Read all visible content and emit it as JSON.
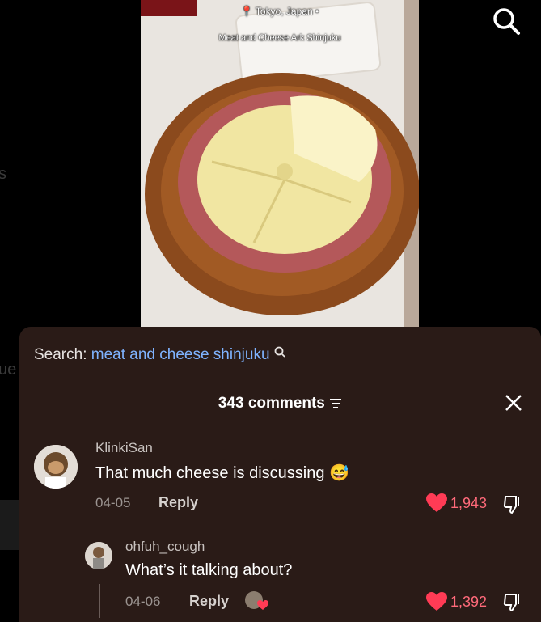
{
  "video": {
    "location": "Tokyo, Japan",
    "caption": "Meat and Cheese Ark Shinjuku"
  },
  "comments_panel": {
    "search_label": "Search:",
    "search_query": "meat and cheese shinjuku",
    "count": "343 comments"
  },
  "comments": [
    {
      "username": "KlinkiSan",
      "text": "That much cheese is discussing",
      "date": "04-05",
      "reply_label": "Reply",
      "likes": "1,943"
    },
    {
      "username": "ohfuh_cough",
      "text": "What’s it talking about?",
      "date": "04-06",
      "reply_label": "Reply",
      "likes": "1,392"
    }
  ],
  "colors": {
    "sheet_bg": "#2a1b17",
    "accent_like": "#ff3b55",
    "search_link": "#7fb3ff"
  },
  "icons": [
    "search-icon",
    "filter-icon",
    "close-icon",
    "heart-icon",
    "dislike-icon",
    "location-pin-icon",
    "emoji-sweat-smile-icon"
  ]
}
